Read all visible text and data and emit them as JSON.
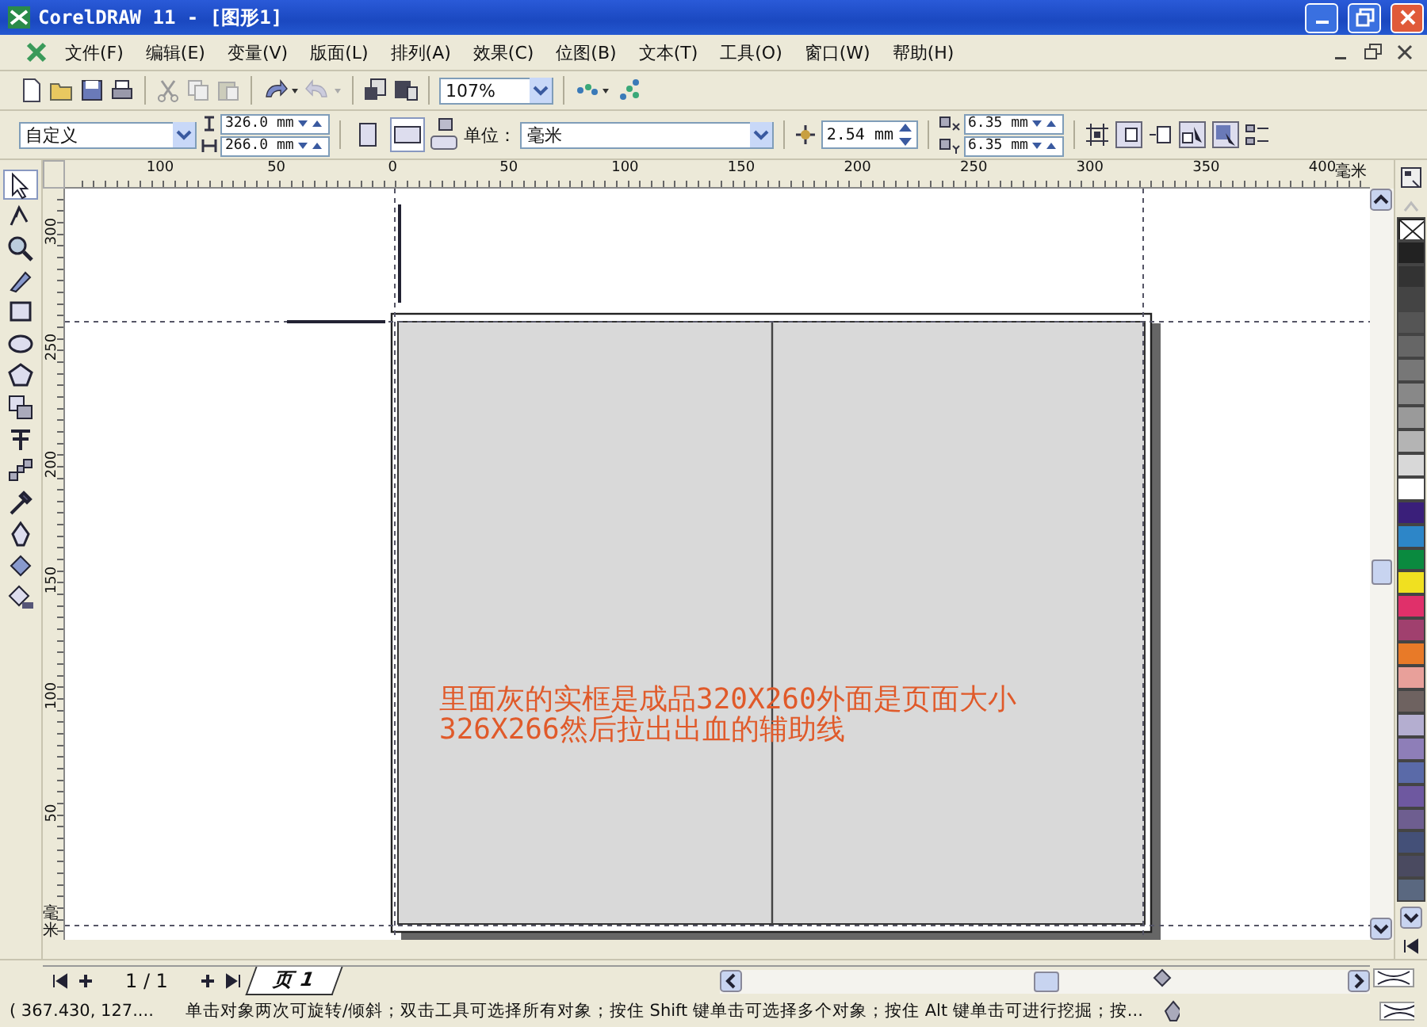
{
  "window": {
    "title": "CorelDRAW 11 - [图形1]"
  },
  "menu": [
    "文件(F)",
    "编辑(E)",
    "变量(V)",
    "版面(L)",
    "排列(A)",
    "效果(C)",
    "位图(B)",
    "文本(T)",
    "工具(O)",
    "窗口(W)",
    "帮助(H)"
  ],
  "toolbar": {
    "zoom": "107%"
  },
  "property_bar": {
    "paper": "自定义",
    "width": "326.0 mm",
    "height": "266.0 mm",
    "unit_label": "单位：",
    "unit": "毫米",
    "nudge": "2.54 mm",
    "dup_x": "6.35 mm",
    "dup_y": "6.35 mm",
    "orientation_buttons": [
      {
        "kind": "portrait",
        "selected": false
      },
      {
        "kind": "landscape",
        "selected": true
      }
    ]
  },
  "toolbox": [
    {
      "kind": "pick",
      "selected": true
    },
    {
      "kind": "shape",
      "selected": false
    },
    {
      "kind": "zoom",
      "selected": false
    },
    {
      "kind": "freehand",
      "selected": false
    },
    {
      "kind": "rectangle",
      "selected": false
    },
    {
      "kind": "ellipse",
      "selected": false
    },
    {
      "kind": "polygon",
      "selected": false
    },
    {
      "kind": "shapes",
      "selected": false
    },
    {
      "kind": "text",
      "selected": false
    },
    {
      "kind": "blend",
      "selected": false
    },
    {
      "kind": "eyedropper",
      "selected": false
    },
    {
      "kind": "pen",
      "selected": false
    },
    {
      "kind": "fill",
      "selected": false
    },
    {
      "kind": "bucket",
      "selected": false
    }
  ],
  "rulers": {
    "horizontal": [
      "100",
      "50",
      "0",
      "50",
      "100",
      "150",
      "200",
      "250",
      "300",
      "350",
      "400"
    ],
    "horizontal_unit": "毫米",
    "vertical": [
      "300",
      "250",
      "200",
      "150",
      "100",
      "50"
    ],
    "vertical_unit": "毫米"
  },
  "canvas": {
    "annotation": "里面灰的实框是成品320X260外面是页面大小\n326X266然后拉出出血的辅助线"
  },
  "palette": [
    {
      "color": "#222222"
    },
    {
      "color": "#333333"
    },
    {
      "color": "#444444"
    },
    {
      "color": "#555555"
    },
    {
      "color": "#666666"
    },
    {
      "color": "#777777"
    },
    {
      "color": "#888888"
    },
    {
      "color": "#9a9a9a"
    },
    {
      "color": "#b4b4b4"
    },
    {
      "color": "#d8d8d8"
    },
    {
      "color": "#ffffff"
    },
    {
      "color": "#3a1f7a"
    },
    {
      "color": "#2d86c8"
    },
    {
      "color": "#0a8a3f"
    },
    {
      "color": "#f0e020"
    },
    {
      "color": "#e0306a"
    },
    {
      "color": "#a0406e"
    },
    {
      "color": "#e87a28"
    },
    {
      "color": "#e8a09a"
    },
    {
      "color": "#6e6260"
    },
    {
      "color": "#b4aed0"
    },
    {
      "color": "#8e7eb8"
    },
    {
      "color": "#5a6aa8"
    },
    {
      "color": "#6e58a0"
    },
    {
      "color": "#6e5e90"
    },
    {
      "color": "#445078"
    },
    {
      "color": "#4a4a60"
    },
    {
      "color": "#5a6880"
    }
  ],
  "page_nav": {
    "count": "1 / 1",
    "tabs": [
      {
        "label": "页 1",
        "selected": true
      }
    ]
  },
  "status_bar": {
    "coords": "( 367.430, 127....",
    "hint": "单击对象两次可旋转/倾斜；双击工具可选择所有对象；按住 Shift 键单击可选择多个对象；按住 Alt 键单击可进行挖掘；按..."
  }
}
